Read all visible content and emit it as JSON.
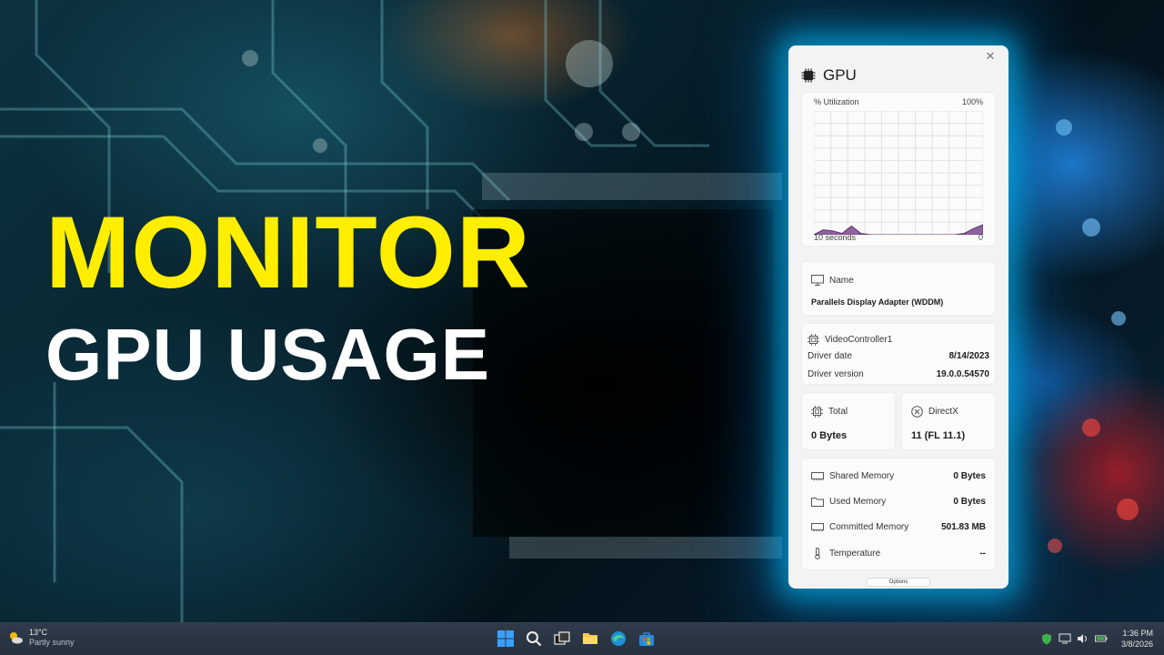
{
  "headline": {
    "line1": "MONITOR",
    "line2": "GPU USAGE"
  },
  "widget": {
    "close_glyph": "✕",
    "title": "GPU",
    "title_icon": "gpu-chip-icon",
    "graph": {
      "util_label": "% Utilization",
      "util_max": "100%",
      "time_label": "10 seconds",
      "time_zero": "0",
      "series_fill": "#7b4a8c",
      "utilization_percent": [
        0,
        4,
        3,
        1,
        7,
        1,
        0,
        0,
        0,
        0,
        0,
        0,
        0,
        0,
        0,
        0,
        1,
        5,
        8
      ]
    },
    "name_card": {
      "label": "Name",
      "icon": "monitor-icon",
      "value": "Parallels Display Adapter (WDDM)"
    },
    "driver_card": {
      "label": "VideoController1",
      "icon": "chip-icon",
      "date_label": "Driver date",
      "date_value": "8/14/2023",
      "version_label": "Driver version",
      "version_value": "19.0.0.54570"
    },
    "total_card": {
      "label": "Total",
      "icon": "chip-icon",
      "value": "0 Bytes"
    },
    "directx_card": {
      "label": "DirectX",
      "icon": "directx-icon",
      "value": "11 (FL 11.1)"
    },
    "memory": [
      {
        "label": "Shared Memory",
        "icon": "memory-icon",
        "value": "0 Bytes"
      },
      {
        "label": "Used Memory",
        "icon": "folder-icon",
        "value": "0 Bytes"
      },
      {
        "label": "Committed Memory",
        "icon": "memory-icon",
        "value": "501.83 MB"
      },
      {
        "label": "Temperature",
        "icon": "thermometer-icon",
        "value": "--"
      }
    ],
    "options_label": "Options"
  },
  "taskbar": {
    "weather_temp": "13°C",
    "weather_condition": "Partly sunny",
    "apps": [
      "start-icon",
      "search-icon",
      "task-view-icon",
      "file-explorer-icon",
      "edge-icon",
      "store-icon"
    ],
    "tray": [
      "security-icon",
      "network-icon",
      "volume-icon",
      "battery-icon"
    ],
    "time": "1:36 PM",
    "date": "3/8/2026"
  },
  "colors": {
    "headline_yellow": "#ffee00",
    "headline_white": "#ffffff",
    "panel_glow": "#00c8ff",
    "graph_fill": "#7b4a8c"
  }
}
